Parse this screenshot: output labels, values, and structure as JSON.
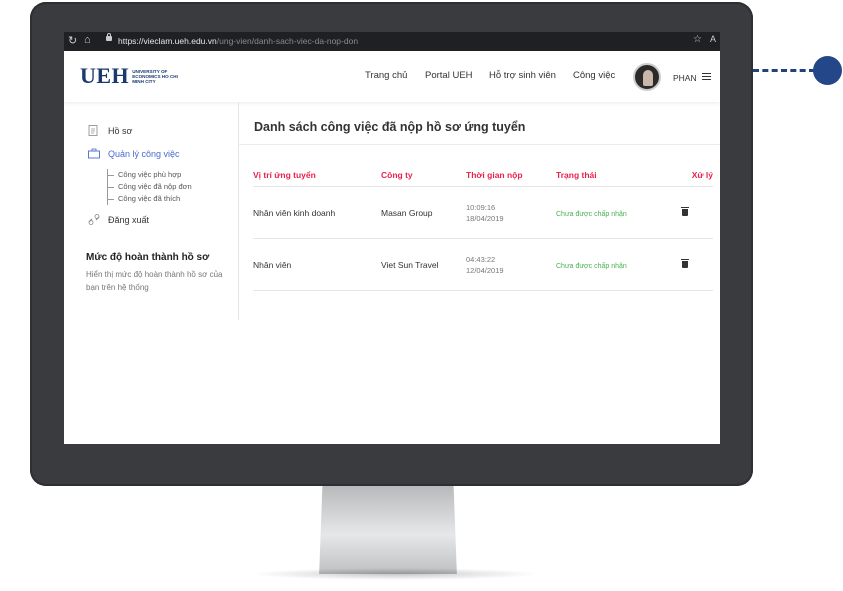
{
  "browser": {
    "url_host": "https://vieclam.ueh.edu.vn",
    "url_path": "/ung-vien/danh-sach-viec-da-nop-don"
  },
  "header": {
    "logo_mark": "UEH",
    "logo_sub": "UNIVERSITY OF ECONOMICS HO CHI MINH CITY",
    "menu": [
      "Trang chủ",
      "Portal UEH",
      "Hỗ trợ sinh viên",
      "Công việc"
    ],
    "user_name": "PHAN"
  },
  "sidebar": {
    "profile": "Hồ sơ",
    "job_management": "Quản lý công việc",
    "sub_items": [
      "Công việc phù hợp",
      "Công việc đã nộp đơn",
      "Công việc đã thích"
    ],
    "logout": "Đăng xuất",
    "completion_title": "Mức độ hoàn thành hồ sơ",
    "completion_desc": "Hiển thị mức độ hoàn thành hồ sơ của bạn trên hệ thống"
  },
  "main": {
    "title": "Danh sách công việc đã nộp hồ sơ ứng tuyển",
    "columns": [
      "Vị trí ứng tuyển",
      "Công ty",
      "Thời gian nộp",
      "Trạng thái",
      "Xử lý"
    ],
    "rows": [
      {
        "position": "Nhân viên kinh doanh",
        "company": "Masan Group",
        "time": "10:09:16",
        "date": "18/04/2019",
        "status": "Chưa được chấp nhận"
      },
      {
        "position": "Nhân viên",
        "company": "Viet Sun Travel",
        "time": "04:43:22",
        "date": "12/04/2019",
        "status": "Chưa được chấp nhận"
      }
    ]
  },
  "colors": {
    "accent": "#e8234a",
    "brand": "#1a3a6e",
    "active": "#4a6ad0",
    "status": "#4caf50",
    "connector": "#24478a"
  }
}
